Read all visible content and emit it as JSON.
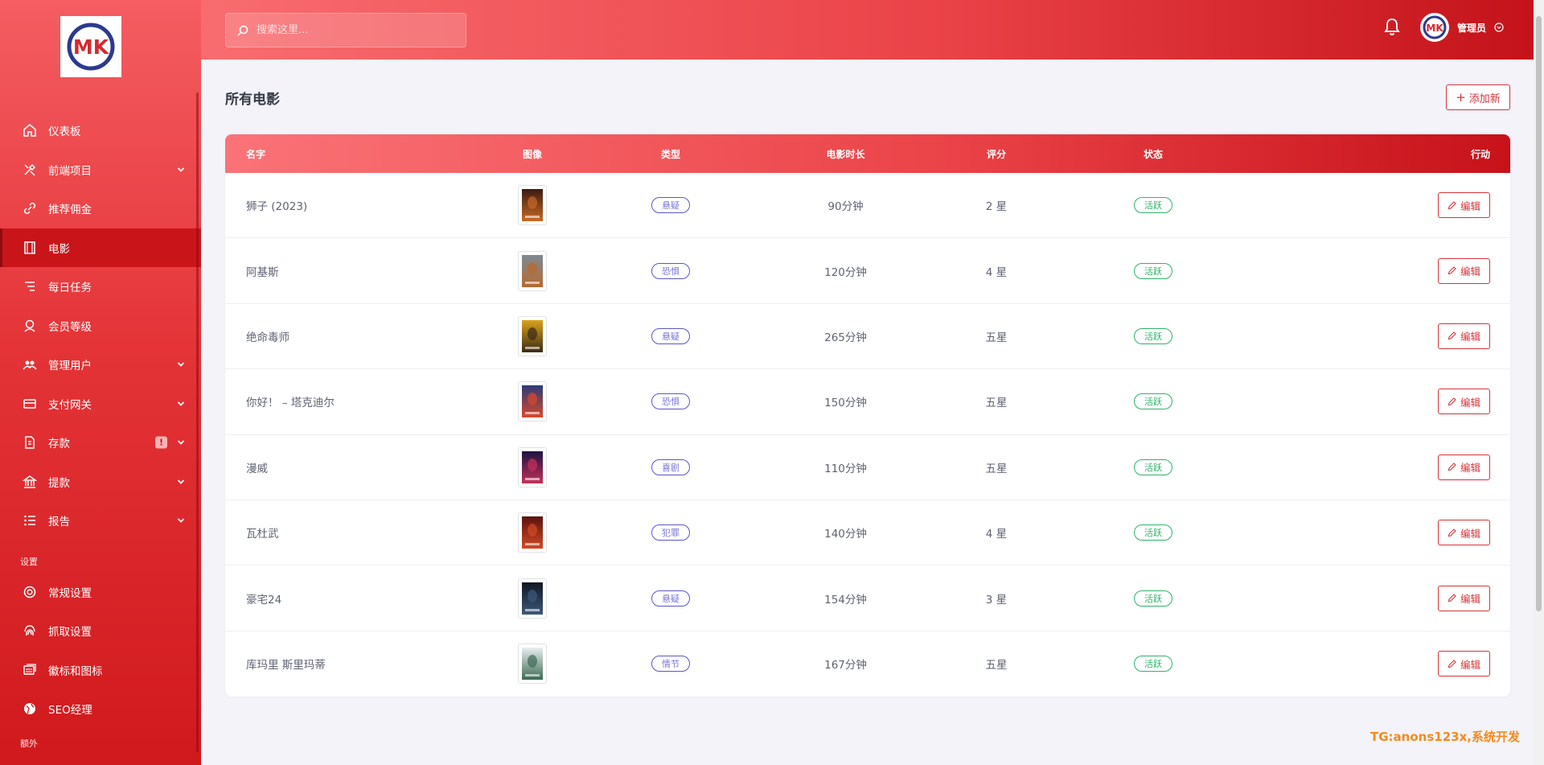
{
  "logo": {
    "text": "MK"
  },
  "sidebar": {
    "items": [
      {
        "label": "仪表板",
        "icon": "home-icon",
        "chevron": false,
        "active": false
      },
      {
        "label": "前端项目",
        "icon": "tools-icon",
        "chevron": true,
        "active": false
      },
      {
        "label": "推荐佣金",
        "icon": "link-icon",
        "chevron": false,
        "active": false
      },
      {
        "label": "电影",
        "icon": "film-icon",
        "chevron": false,
        "active": true
      },
      {
        "label": "每日任务",
        "icon": "tasks-icon",
        "chevron": false,
        "active": false
      },
      {
        "label": "会员等级",
        "icon": "member-icon",
        "chevron": false,
        "active": false
      },
      {
        "label": "管理用户",
        "icon": "users-icon",
        "chevron": true,
        "active": false
      },
      {
        "label": "支付网关",
        "icon": "credit-card-icon",
        "chevron": true,
        "active": false
      },
      {
        "label": "存款",
        "icon": "deposit-icon",
        "chevron": true,
        "active": false,
        "badge": "!"
      },
      {
        "label": "提款",
        "icon": "bank-icon",
        "chevron": true,
        "active": false
      },
      {
        "label": "报告",
        "icon": "list-icon",
        "chevron": true,
        "active": false
      }
    ],
    "section_settings": "设置",
    "settings_items": [
      {
        "label": "常规设置",
        "icon": "lifebuoy-icon"
      },
      {
        "label": "抓取设置",
        "icon": "fingerprint-icon"
      },
      {
        "label": "徽标和图标",
        "icon": "images-icon"
      },
      {
        "label": "SEO经理",
        "icon": "globe-icon"
      }
    ],
    "section_extra": "额外"
  },
  "header": {
    "search_placeholder": "搜索这里...",
    "user_name": "管理员"
  },
  "main": {
    "title": "所有电影",
    "add_label": "添加新"
  },
  "table": {
    "headers": {
      "name": "名字",
      "image": "图像",
      "type": "类型",
      "duration": "电影时长",
      "rating": "评分",
      "status": "状态",
      "action": "行动"
    },
    "edit_label": "编辑",
    "rows": [
      {
        "name": "狮子 (2023)",
        "type": "悬疑",
        "duration": "90分钟",
        "rating": "2 星",
        "status": "活跃",
        "poster": [
          "#3b1a12",
          "#c86a23"
        ]
      },
      {
        "name": "阿基斯",
        "type": "恐惧",
        "duration": "120分钟",
        "rating": "4 星",
        "status": "活跃",
        "poster": [
          "#7d8a94",
          "#b7692f"
        ]
      },
      {
        "name": "绝命毒师",
        "type": "悬疑",
        "duration": "265分钟",
        "rating": "五星",
        "status": "活跃",
        "poster": [
          "#d9a21c",
          "#3b2a14"
        ]
      },
      {
        "name": "你好！ – 塔克迪尔",
        "type": "恐惧",
        "duration": "150分钟",
        "rating": "五星",
        "status": "活跃",
        "poster": [
          "#2a3b7a",
          "#d9482b"
        ]
      },
      {
        "name": "漫威",
        "type": "喜剧",
        "duration": "110分钟",
        "rating": "五星",
        "status": "活跃",
        "poster": [
          "#1b1242",
          "#c8305a"
        ]
      },
      {
        "name": "瓦杜武",
        "type": "犯罪",
        "duration": "140分钟",
        "rating": "4 星",
        "status": "活跃",
        "poster": [
          "#5a120f",
          "#d34a24"
        ]
      },
      {
        "name": "豪宅24",
        "type": "悬疑",
        "duration": "154分钟",
        "rating": "3 星",
        "status": "活跃",
        "poster": [
          "#0f1624",
          "#3d5a7a"
        ]
      },
      {
        "name": "库玛里 斯里玛蒂",
        "type": "情节",
        "duration": "167分钟",
        "rating": "五星",
        "status": "活跃",
        "poster": [
          "#e9eef0",
          "#3c6a54"
        ]
      }
    ]
  },
  "watermark": "TG:anons123x,系统开发",
  "colors": {
    "sidebar_top": "#f45d62",
    "sidebar_bottom": "#d0191d",
    "accent": "#d63339",
    "type_badge": "#5b56c8",
    "status_badge": "#2fb36a",
    "watermark": "#f48a1e"
  }
}
